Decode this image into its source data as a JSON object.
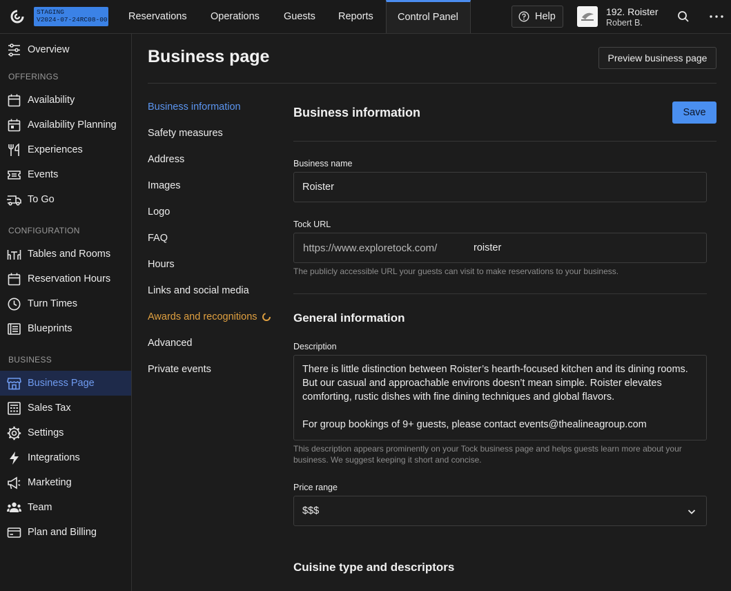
{
  "env": {
    "line1": "STAGING",
    "line2": "V2024-07-24RC08-00"
  },
  "topnav": {
    "tabs": [
      "Reservations",
      "Operations",
      "Guests",
      "Reports",
      "Control Panel"
    ],
    "active_tab": "Control Panel",
    "help_label": "Help",
    "venue_name": "192. Roister",
    "user_name": "Robert B."
  },
  "sidebar": {
    "overview": "Overview",
    "sections": {
      "offerings": "OFFERINGS",
      "configuration": "CONFIGURATION",
      "business": "BUSINESS"
    },
    "offerings": [
      "Availability",
      "Availability Planning",
      "Experiences",
      "Events",
      "To Go"
    ],
    "configuration": [
      "Tables and Rooms",
      "Reservation Hours",
      "Turn Times",
      "Blueprints"
    ],
    "business": [
      "Business Page",
      "Sales Tax",
      "Settings",
      "Integrations",
      "Marketing",
      "Team",
      "Plan and Billing"
    ],
    "active_item": "Business Page"
  },
  "page": {
    "title": "Business page",
    "preview_label": "Preview business page"
  },
  "subnav": {
    "items": [
      "Business information",
      "Safety measures",
      "Address",
      "Images",
      "Logo",
      "FAQ",
      "Hours",
      "Links and social media",
      "Awards and recognitions",
      "Advanced",
      "Private events"
    ],
    "active_item": "Business information",
    "warning_item": "Awards and recognitions"
  },
  "form": {
    "section_title": "Business information",
    "save_label": "Save",
    "business_name_label": "Business name",
    "business_name_value": "Roister",
    "tock_url_label": "Tock URL",
    "tock_url_prefix": "https://www.exploretock.com/",
    "tock_url_slug": "roister",
    "tock_url_hint": "The publicly accessible URL your guests can visit to make reservations to your business.",
    "general_title": "General information",
    "description_label": "Description",
    "description_p1": "There is little distinction between Roister’s hearth-focused kitchen and its dining rooms. But our casual and approachable environs doesn’t mean simple. Roister elevates comforting, rustic dishes with fine dining techniques and global flavors.",
    "description_p2": "For group bookings of 9+ guests, please contact events@thealineagroup.com",
    "description_hint": "This description appears prominently on your Tock business page and helps guests learn more about your business. We suggest keeping it short and concise.",
    "price_range_label": "Price range",
    "price_range_value": "$$$",
    "cuisine_title": "Cuisine type and descriptors"
  },
  "colors": {
    "accent": "#4a8ff0",
    "warning": "#e0a040",
    "background": "#1c1c1c"
  }
}
